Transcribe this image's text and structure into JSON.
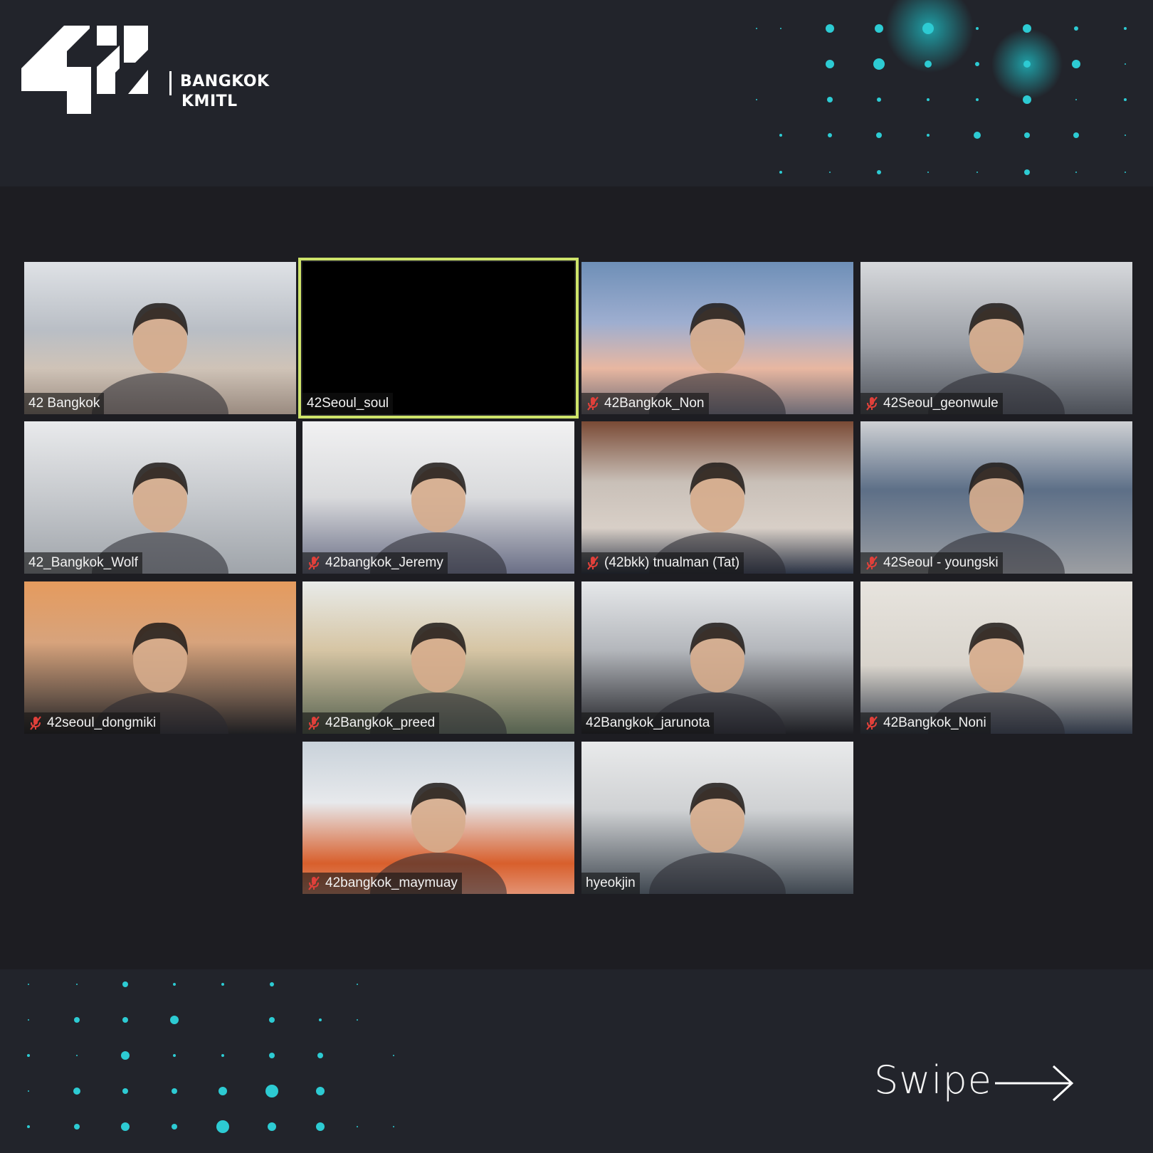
{
  "brand": {
    "logo_mark": "42",
    "line1": "BANGKOK",
    "line2": "KMITL"
  },
  "accent_color": "#29c6cf",
  "highlight_color": "#cde36a",
  "participants": [
    {
      "name": "42 Bangkok",
      "muted": false,
      "video": true,
      "icon": "none"
    },
    {
      "name": "42Seoul_soul",
      "muted": false,
      "video": false,
      "active_speaker": true,
      "icon": "none"
    },
    {
      "name": "42Bangkok_Non",
      "muted": true,
      "video": true,
      "icon": "mic-off-icon"
    },
    {
      "name": "42Seoul_geonwule",
      "muted": true,
      "video": true,
      "icon": "mic-off-icon"
    },
    {
      "name": "42_Bangkok_Wolf",
      "muted": false,
      "video": true,
      "icon": "none"
    },
    {
      "name": "42bangkok_Jeremy",
      "muted": true,
      "video": true,
      "icon": "mic-off-icon"
    },
    {
      "name": "(42bkk) tnualman (Tat)",
      "muted": true,
      "video": true,
      "icon": "mic-off-icon"
    },
    {
      "name": "42Seoul - youngski",
      "muted": true,
      "video": true,
      "icon": "mic-off-icon"
    },
    {
      "name": "42seoul_dongmiki",
      "muted": true,
      "video": true,
      "icon": "mic-off-icon"
    },
    {
      "name": "42Bangkok_preed",
      "muted": true,
      "video": true,
      "icon": "mic-off-icon"
    },
    {
      "name": "42Bangkok_jarunota",
      "muted": false,
      "video": true,
      "icon": "none"
    },
    {
      "name": "42Bangkok_Noni",
      "muted": true,
      "video": true,
      "icon": "mic-off-icon"
    },
    {
      "name": "42bangkok_maymuay",
      "muted": true,
      "video": true,
      "icon": "mic-off-icon"
    },
    {
      "name": "hyeokjin",
      "muted": false,
      "video": true,
      "icon": "none"
    }
  ],
  "cta": {
    "label": "Swipe",
    "icon": "arrow-right-icon"
  }
}
